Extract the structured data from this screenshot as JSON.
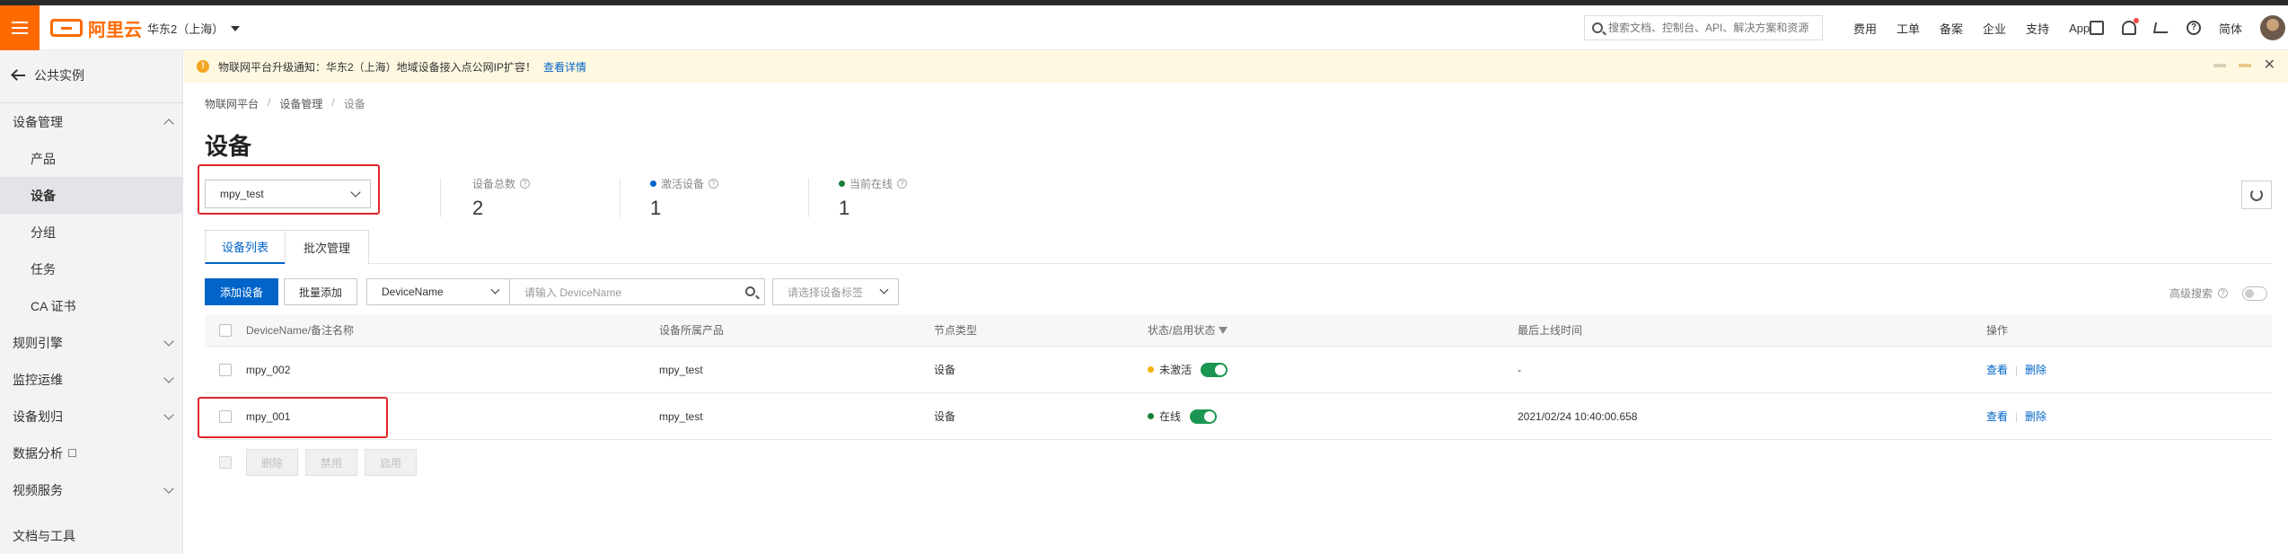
{
  "topbar": {
    "logo_text": "阿里云",
    "region": "华东2（上海）",
    "search_placeholder": "搜索文档、控制台、API、解决方案和资源",
    "links": [
      "费用",
      "工单",
      "备案",
      "企业",
      "支持",
      "App"
    ],
    "lang": "简体"
  },
  "sidebar": {
    "back_label": "公共实例",
    "items": [
      {
        "label": "设备管理"
      },
      {
        "label": "产品"
      },
      {
        "label": "设备"
      },
      {
        "label": "分组"
      },
      {
        "label": "任务"
      },
      {
        "label": "CA 证书"
      },
      {
        "label": "规则引擎"
      },
      {
        "label": "监控运维"
      },
      {
        "label": "设备划归"
      },
      {
        "label": "数据分析"
      },
      {
        "label": "视频服务"
      },
      {
        "label": "文档与工具"
      }
    ]
  },
  "notice": {
    "text": "物联网平台升级通知：华东2（上海）地域设备接入点公网IP扩容！",
    "link": "查看详情"
  },
  "breadcrumb": [
    "物联网平台",
    "设备管理",
    "设备"
  ],
  "page_title": "设备",
  "product_filter": "mpy_test",
  "stats": {
    "total_label": "设备总数",
    "total_value": "2",
    "activated_label": "激活设备",
    "activated_value": "1",
    "online_label": "当前在线",
    "online_value": "1"
  },
  "tabs": [
    "设备列表",
    "批次管理"
  ],
  "toolbar": {
    "add_device": "添加设备",
    "batch_add": "批量添加",
    "field_select": "DeviceName",
    "input_placeholder": "请输入 DeviceName",
    "tag_placeholder": "请选择设备标签",
    "advanced_search": "高级搜索"
  },
  "table": {
    "headers": [
      "DeviceName/备注名称",
      "设备所属产品",
      "节点类型",
      "状态/启用状态",
      "最后上线时间",
      "操作"
    ],
    "rows": [
      {
        "name": "mpy_002",
        "product": "mpy_test",
        "node_type": "设备",
        "status": "未激活",
        "status_color": "#f5b400",
        "last_online": "-",
        "op_view": "查看",
        "op_delete": "删除"
      },
      {
        "name": "mpy_001",
        "product": "mpy_test",
        "node_type": "设备",
        "status": "在线",
        "status_color": "#1a7f37",
        "last_online": "2021/02/24 10:40:00.658",
        "op_view": "查看",
        "op_delete": "删除"
      }
    ],
    "bulk_actions": [
      "删除",
      "禁用",
      "启用"
    ]
  },
  "colors": {
    "brand": "#ff6a00",
    "primary": "#0064c8",
    "highlight_box": "#e0262b",
    "activated_dot": "#0064c8",
    "online_dot": "#1a7f37"
  }
}
